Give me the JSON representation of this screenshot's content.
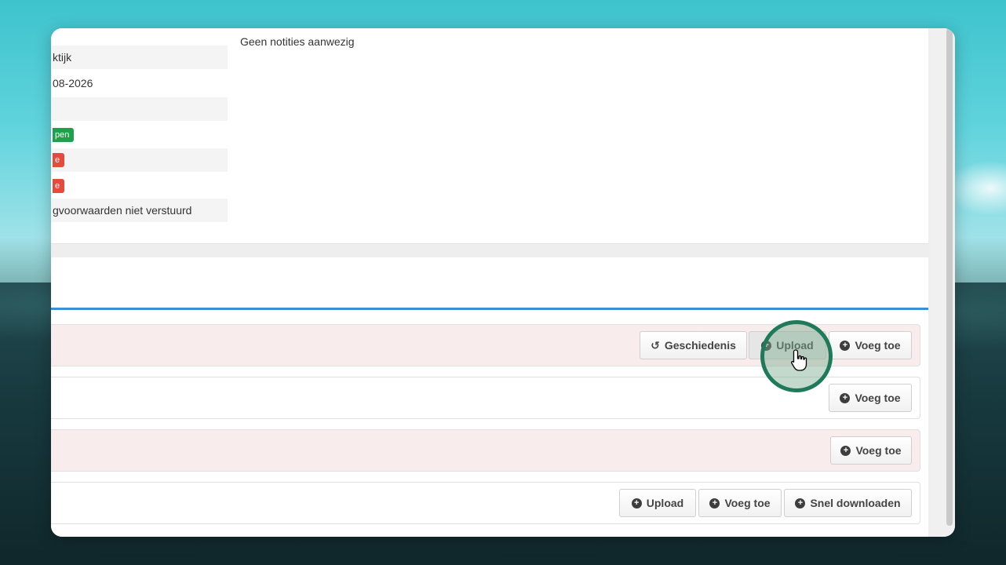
{
  "info": {
    "row1": "ktijk",
    "row2": "08-2026",
    "row3": "",
    "badge_green": "pen",
    "badge_red1": "e",
    "badge_red2": "e",
    "row7": "gvoorwaarden niet verstuurd"
  },
  "notes": {
    "text": "Geen notities aanwezig"
  },
  "rows": [
    {
      "buttons": {
        "history": "Geschiedenis",
        "upload": "Upload",
        "add": "Voeg toe"
      }
    },
    {
      "buttons": {
        "add": "Voeg toe"
      }
    },
    {
      "buttons": {
        "add": "Voeg toe"
      }
    },
    {
      "buttons": {
        "upload": "Upload",
        "add": "Voeg toe",
        "download": "Snel downloaden"
      }
    }
  ],
  "colors": {
    "accent_line": "#3b8fd9",
    "highlight_ring": "#1e7a5a",
    "badge_green": "#1fa04b",
    "badge_red": "#e54b3c"
  }
}
